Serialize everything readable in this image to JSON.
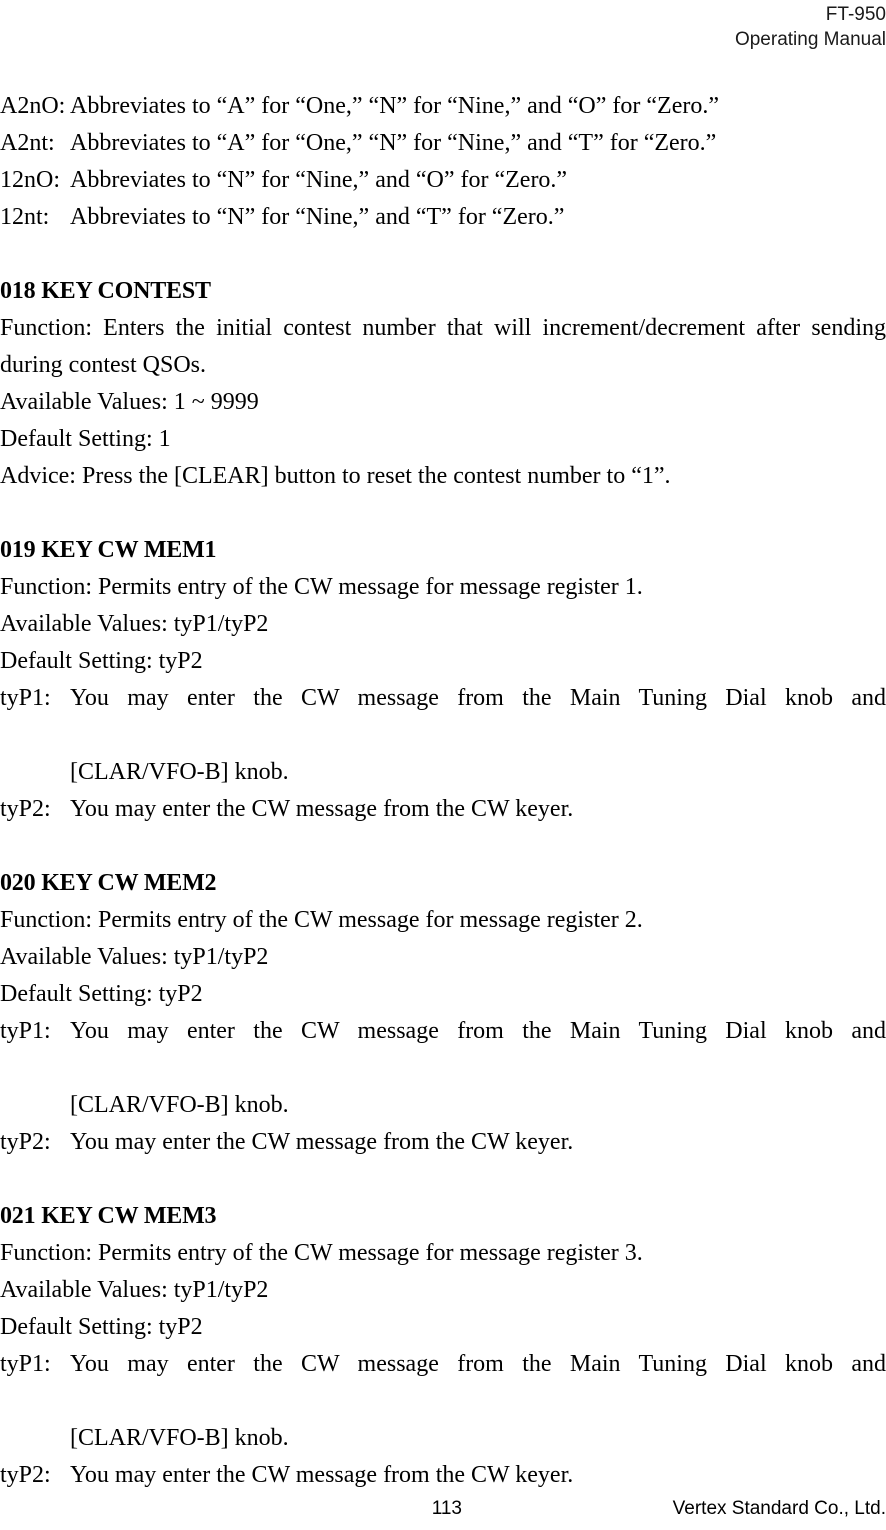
{
  "header": {
    "model": "FT-950",
    "manual": "Operating Manual"
  },
  "abbreviations": [
    {
      "label": "A2nO:",
      "text": "Abbreviates to “A” for “One,” “N” for “Nine,” and “O” for “Zero.”"
    },
    {
      "label": "A2nt:",
      "text": "Abbreviates to “A” for “One,” “N” for “Nine,” and “T” for “Zero.”"
    },
    {
      "label": "12nO:",
      "text": "Abbreviates to “N” for “Nine,” and “O” for “Zero.”"
    },
    {
      "label": "12nt:",
      "text": "Abbreviates to “N” for “Nine,” and “T” for “Zero.”"
    }
  ],
  "menu_items": [
    {
      "heading": "018 KEY CONTEST",
      "function_line1": "Function: Enters the initial contest number that will increment/decrement after",
      "function_line2": "sending during contest QSOs.",
      "available_values": "Available Values: 1 ~ 9999",
      "default_setting": "Default Setting: 1",
      "advice": "Advice: Press the [CLEAR] button to reset the contest number to “1”."
    },
    {
      "heading": "019 KEY CW MEM1",
      "function_line1": "Function: Permits entry of the CW message for message register 1.",
      "available_values": "Available Values: tyP1/tyP2",
      "default_setting": "Default Setting: tyP2",
      "type1_label": "tyP1:",
      "type1_line1": "You may enter the CW message from the Main Tuning Dial knob and",
      "type1_line2": "[CLAR/VFO-B] knob.",
      "type2_label": "tyP2:",
      "type2_line1": "You may enter the CW message from the CW keyer."
    },
    {
      "heading": "020 KEY CW MEM2",
      "function_line1": "Function: Permits entry of the CW message for message register 2.",
      "available_values": "Available Values: tyP1/tyP2",
      "default_setting": "Default Setting: tyP2",
      "type1_label": "tyP1:",
      "type1_line1": "You may enter the CW message from the Main Tuning Dial knob and",
      "type1_line2": "[CLAR/VFO-B] knob.",
      "type2_label": "tyP2:",
      "type2_line1": "You may enter the CW message from the CW keyer."
    },
    {
      "heading": "021 KEY CW MEM3",
      "function_line1": "Function: Permits entry of the CW message for message register 3.",
      "available_values": "Available Values: tyP1/tyP2",
      "default_setting": "Default Setting: tyP2",
      "type1_label": "tyP1:",
      "type1_line1": "You may enter the CW message from the Main Tuning Dial knob and",
      "type1_line2": "[CLAR/VFO-B] knob.",
      "type2_label": "tyP2:",
      "type2_line1": "You may enter the CW message from the CW keyer."
    }
  ],
  "footer": {
    "page_number": "113",
    "company": "Vertex Standard Co., Ltd."
  }
}
